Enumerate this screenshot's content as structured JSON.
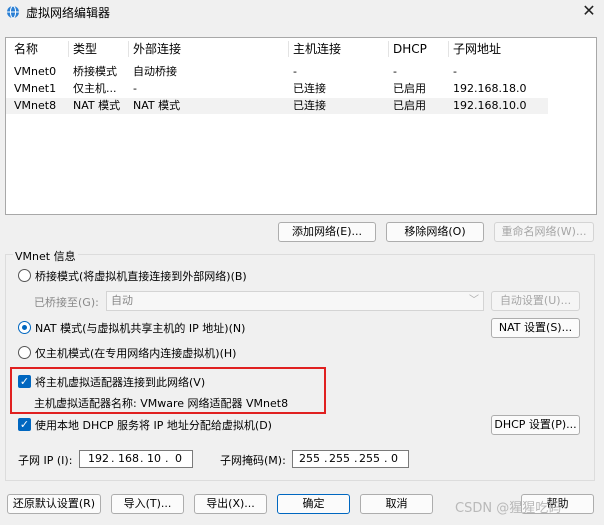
{
  "window": {
    "title": "虚拟网络编辑器",
    "close_glyph": "✕"
  },
  "network_table": {
    "columns": [
      "名称",
      "类型",
      "外部连接",
      "主机连接",
      "DHCP",
      "子网地址"
    ],
    "rows": [
      {
        "name": "VMnet0",
        "type": "桥接模式",
        "external": "自动桥接",
        "host": "-",
        "dhcp": "-",
        "subnet": "-",
        "selected": false
      },
      {
        "name": "VMnet1",
        "type": "仅主机...",
        "external": "-",
        "host": "已连接",
        "dhcp": "已启用",
        "subnet": "192.168.18.0",
        "selected": false
      },
      {
        "name": "VMnet8",
        "type": "NAT 模式",
        "external": "NAT 模式",
        "host": "已连接",
        "dhcp": "已启用",
        "subnet": "192.168.10.0",
        "selected": true
      }
    ]
  },
  "list_buttons": {
    "add": "添加网络(E)...",
    "remove": "移除网络(O)",
    "rename": "重命名网络(W)..."
  },
  "vmnet_info": {
    "group_label": "VMnet 信息",
    "bridged_radio": "桥接模式(将虚拟机直接连接到外部网络)(B)",
    "bridged_to_label": "已桥接至(G):",
    "bridged_to_value": "自动",
    "auto_settings_button": "自动设置(U)...",
    "nat_radio": "NAT 模式(与虚拟机共享主机的 IP 地址)(N)",
    "nat_settings_button": "NAT 设置(S)...",
    "hostonly_radio": "仅主机模式(在专用网络内连接虚拟机)(H)",
    "connect_adapter_checkbox": "将主机虚拟适配器连接到此网络(V)",
    "adapter_name_text": "主机虚拟适配器名称: VMware 网络适配器 VMnet8",
    "dhcp_checkbox": "使用本地 DHCP 服务将 IP 地址分配给虚拟机(D)",
    "dhcp_settings_button": "DHCP 设置(P)...",
    "subnet_ip_label": "子网 IP (I):",
    "subnet_ip": [
      "192",
      "168",
      "10",
      "0"
    ],
    "subnet_mask_label": "子网掩码(M):",
    "subnet_mask": [
      "255",
      "255",
      "255",
      "0"
    ],
    "selected_mode": "nat",
    "connect_adapter_checked": true,
    "dhcp_checked": true
  },
  "footer_buttons": {
    "restore_defaults": "还原默认设置(R)",
    "import": "导入(T)...",
    "export": "导出(X)...",
    "ok": "确定",
    "cancel": "取消",
    "help": "帮助"
  },
  "watermark": "CSDN @猩猩吃码",
  "colors": {
    "accent": "#0067c0",
    "highlight_box": "#e02020",
    "selected_row": "#f2f2f2"
  },
  "icons": {
    "app": "network-editor-icon",
    "close": "close-icon",
    "dropdown": "chevron-down-icon",
    "check": "checkmark-icon"
  }
}
